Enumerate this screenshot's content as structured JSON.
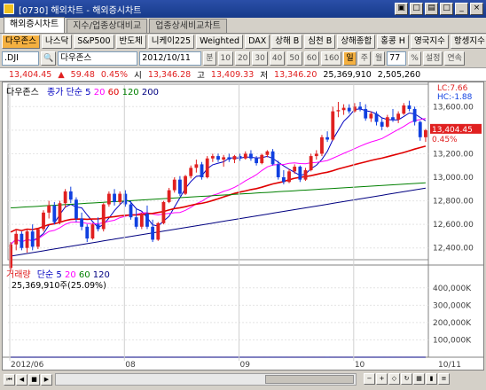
{
  "window": {
    "title": "[0730] 해외차트 - 해외증시차트",
    "buttons": [
      "▣",
      "□",
      "▤",
      "□",
      "_",
      "×"
    ]
  },
  "tabs": [
    {
      "label": "해외증시차트"
    },
    {
      "label": "지수/업종상대비교"
    },
    {
      "label": "업종상세비교차트"
    }
  ],
  "markets": [
    "다우존스",
    "나스닥",
    "S&P500",
    "반도체",
    "니케이225",
    "Weighted",
    "DAX",
    "상해 B",
    "심천 B",
    "상해종합",
    "홍콩 H",
    "영국지수",
    "항셍지수"
  ],
  "controls": {
    "symbol": ".DJI",
    "search_label": "🔍",
    "name": "다우존스",
    "date": "2012/10/11",
    "period_labels": [
      "분",
      "10",
      "20",
      "30",
      "40",
      "50",
      "60",
      "160"
    ],
    "day_label": "일",
    "week_label": "주",
    "month_label": "월",
    "count": "77",
    "zoom_label": "%",
    "settings_label": "설정",
    "continuous_label": "연속"
  },
  "price_info": {
    "last": "13,404.45",
    "change": "59.48",
    "pct": "0.45%",
    "open_label": "시",
    "open": "13,346.28",
    "high_label": "고",
    "high": "13,409.33",
    "low_label": "저",
    "low": "13,346.20",
    "volume": "25,369,910",
    "value": "2,505,260"
  },
  "price_chart": {
    "name": "다우존스",
    "ma_label": "종가 단순",
    "ma": [
      "5",
      "20",
      "60",
      "120",
      "200"
    ],
    "ma_colors": [
      "#0000c0",
      "#ff00ff",
      "#e00000",
      "#008000",
      "#000080"
    ],
    "lc": "LC:7.66",
    "hc": "HC:-1.88",
    "current_price": "13,404.45",
    "current_pct": "0.45%",
    "y_ticks": [
      "13,600.00",
      "13,400.00",
      "13,200.00",
      "13,000.00",
      "12,800.00",
      "12,600.00",
      "12,400.00"
    ]
  },
  "volume_chart": {
    "label": "거래량",
    "ma_label": "단순",
    "ma": [
      "5",
      "20",
      "60",
      "120"
    ],
    "ma_colors": [
      "#0000c0",
      "#ff00ff",
      "#008000",
      "#000080"
    ],
    "current": "25,369,910주(25.09%)",
    "y_ticks": [
      "400,000K",
      "300,000K",
      "200,000K",
      "100,000K"
    ]
  },
  "x_ticks": [
    "2012/06",
    "08",
    "09",
    "10",
    "10/11"
  ],
  "colors": {
    "up": "#e02020",
    "down": "#1040e0",
    "accent": "#f4b040",
    "title": "#2b4fa8"
  },
  "chart_data": {
    "type": "candlestick",
    "title": "다우존스",
    "x_range": [
      "2012/06",
      "2012/10/11"
    ],
    "ylim": [
      12300,
      13700
    ],
    "volume_ylim": [
      0,
      450000
    ],
    "volume_unit": "K",
    "candles": [
      [
        12230,
        12450,
        12200,
        12430
      ],
      [
        12430,
        12560,
        12380,
        12520
      ],
      [
        12520,
        12540,
        12380,
        12400
      ],
      [
        12400,
        12560,
        12360,
        12540
      ],
      [
        12540,
        12600,
        12380,
        12410
      ],
      [
        12410,
        12570,
        12390,
        12560
      ],
      [
        12560,
        12720,
        12540,
        12700
      ],
      [
        12700,
        12800,
        12650,
        12760
      ],
      [
        12760,
        12790,
        12600,
        12620
      ],
      [
        12620,
        12800,
        12600,
        12780
      ],
      [
        12780,
        12900,
        12740,
        12880
      ],
      [
        12880,
        12920,
        12780,
        12810
      ],
      [
        12810,
        12830,
        12620,
        12650
      ],
      [
        12650,
        12700,
        12550,
        12580
      ],
      [
        12580,
        12600,
        12450,
        12480
      ],
      [
        12480,
        12610,
        12470,
        12600
      ],
      [
        12600,
        12660,
        12540,
        12560
      ],
      [
        12560,
        12780,
        12540,
        12770
      ],
      [
        12770,
        12880,
        12750,
        12860
      ],
      [
        12860,
        12900,
        12760,
        12790
      ],
      [
        12790,
        12880,
        12770,
        12860
      ],
      [
        12860,
        12890,
        12750,
        12770
      ],
      [
        12770,
        12800,
        12640,
        12660
      ],
      [
        12660,
        12740,
        12560,
        12580
      ],
      [
        12580,
        12700,
        12560,
        12690
      ],
      [
        12690,
        12760,
        12560,
        12580
      ],
      [
        12580,
        12640,
        12450,
        12470
      ],
      [
        12470,
        12620,
        12460,
        12610
      ],
      [
        12610,
        12800,
        12600,
        12790
      ],
      [
        12790,
        12910,
        12780,
        12890
      ],
      [
        12890,
        13000,
        12870,
        12980
      ],
      [
        12980,
        13010,
        12840,
        12860
      ],
      [
        12860,
        13020,
        12850,
        13010
      ],
      [
        13010,
        13100,
        12990,
        13080
      ],
      [
        13080,
        13150,
        13040,
        13110
      ],
      [
        13110,
        13130,
        12980,
        13000
      ],
      [
        13000,
        13180,
        12990,
        13160
      ],
      [
        13160,
        13200,
        13130,
        13180
      ],
      [
        13180,
        13200,
        13130,
        13150
      ],
      [
        13150,
        13190,
        13090,
        13170
      ],
      [
        13170,
        13200,
        13130,
        13150
      ],
      [
        13150,
        13190,
        13120,
        13180
      ],
      [
        13180,
        13200,
        13140,
        13160
      ],
      [
        13160,
        13220,
        13150,
        13200
      ],
      [
        13200,
        13230,
        13140,
        13160
      ],
      [
        13160,
        13180,
        13100,
        13120
      ],
      [
        13120,
        13200,
        13110,
        13190
      ],
      [
        13190,
        13230,
        13170,
        13220
      ],
      [
        13220,
        13240,
        13100,
        13110
      ],
      [
        13110,
        13140,
        12980,
        13000
      ],
      [
        13000,
        13060,
        12940,
        12960
      ],
      [
        12960,
        13070,
        12950,
        13050
      ],
      [
        13050,
        13110,
        13030,
        13090
      ],
      [
        13090,
        13100,
        12960,
        12980
      ],
      [
        12980,
        13080,
        12970,
        13060
      ],
      [
        13060,
        13200,
        13050,
        13180
      ],
      [
        13180,
        13230,
        13150,
        13200
      ],
      [
        13200,
        13360,
        13180,
        13340
      ],
      [
        13340,
        13390,
        13300,
        13320
      ],
      [
        13320,
        13600,
        13310,
        13560
      ],
      [
        13560,
        13640,
        13510,
        13570
      ],
      [
        13570,
        13620,
        13530,
        13590
      ],
      [
        13590,
        13620,
        13540,
        13560
      ],
      [
        13560,
        13630,
        13550,
        13600
      ],
      [
        13600,
        13640,
        13560,
        13580
      ],
      [
        13580,
        13620,
        13480,
        13500
      ],
      [
        13500,
        13560,
        13470,
        13540
      ],
      [
        13540,
        13560,
        13440,
        13470
      ],
      [
        13470,
        13500,
        13400,
        13430
      ],
      [
        13430,
        13530,
        13420,
        13510
      ],
      [
        13510,
        13580,
        13470,
        13490
      ],
      [
        13490,
        13560,
        13460,
        13540
      ],
      [
        13540,
        13630,
        13530,
        13610
      ],
      [
        13610,
        13650,
        13560,
        13580
      ],
      [
        13580,
        13600,
        13440,
        13470
      ],
      [
        13470,
        13480,
        13310,
        13340
      ],
      [
        13340,
        13410,
        13300,
        13400
      ]
    ],
    "volume": [
      160,
      150,
      180,
      170,
      155,
      140,
      150,
      165,
      120,
      135,
      145,
      150,
      140,
      160,
      175,
      150,
      130,
      140,
      170,
      160,
      150,
      140,
      165,
      175,
      150,
      130,
      180,
      160,
      150,
      155,
      140,
      145,
      170,
      150,
      175,
      140,
      145,
      160,
      130,
      170,
      135,
      160,
      150,
      140,
      150,
      140,
      155,
      150,
      165,
      140,
      170,
      175,
      160,
      140,
      150,
      130,
      150,
      155,
      420,
      160,
      150,
      140,
      150,
      145,
      140,
      150,
      165,
      135,
      140,
      150,
      160,
      155,
      165,
      150,
      160,
      175,
      140
    ]
  }
}
